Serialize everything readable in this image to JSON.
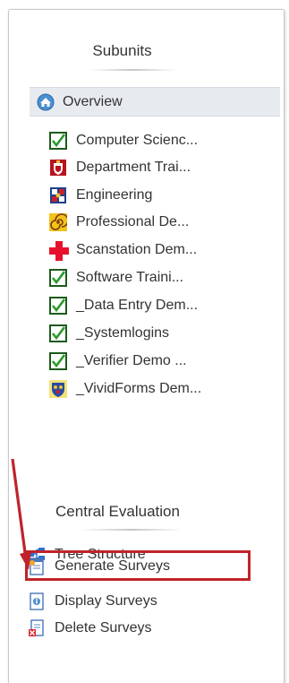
{
  "panel": {
    "subunits_title": "Subunits",
    "overview_label": "Overview",
    "subunits": [
      {
        "label": "Computer Scienc...",
        "icon": "green-check-icon"
      },
      {
        "label": "Department Trai...",
        "icon": "crest-icon"
      },
      {
        "label": "Engineering",
        "icon": "shield-icon"
      },
      {
        "label": "Professional De...",
        "icon": "spiral-logo-icon"
      },
      {
        "label": "Scanstation Dem...",
        "icon": "red-cross-icon"
      },
      {
        "label": "Software Traini...",
        "icon": "green-check-icon"
      },
      {
        "label": "_Data Entry Dem...",
        "icon": "green-check-icon"
      },
      {
        "label": "_Systemlogins",
        "icon": "green-check-icon"
      },
      {
        "label": "_Verifier Demo ...",
        "icon": "green-check-icon"
      },
      {
        "label": "_VividForms Dem...",
        "icon": "coat-of-arms-icon"
      }
    ],
    "central_title": "Central Evaluation",
    "tools": [
      {
        "label": "Tree Structure",
        "icon": "tree-structure-icon"
      },
      {
        "label": "Generate Surveys",
        "icon": "generate-surveys-icon"
      },
      {
        "label": "Display Surveys",
        "icon": "display-surveys-icon"
      },
      {
        "label": "Delete Surveys",
        "icon": "delete-surveys-icon"
      }
    ]
  },
  "colors": {
    "highlight": "#c0232a",
    "arrow": "#c0232a",
    "overview_bg": "#e7ebf0"
  }
}
